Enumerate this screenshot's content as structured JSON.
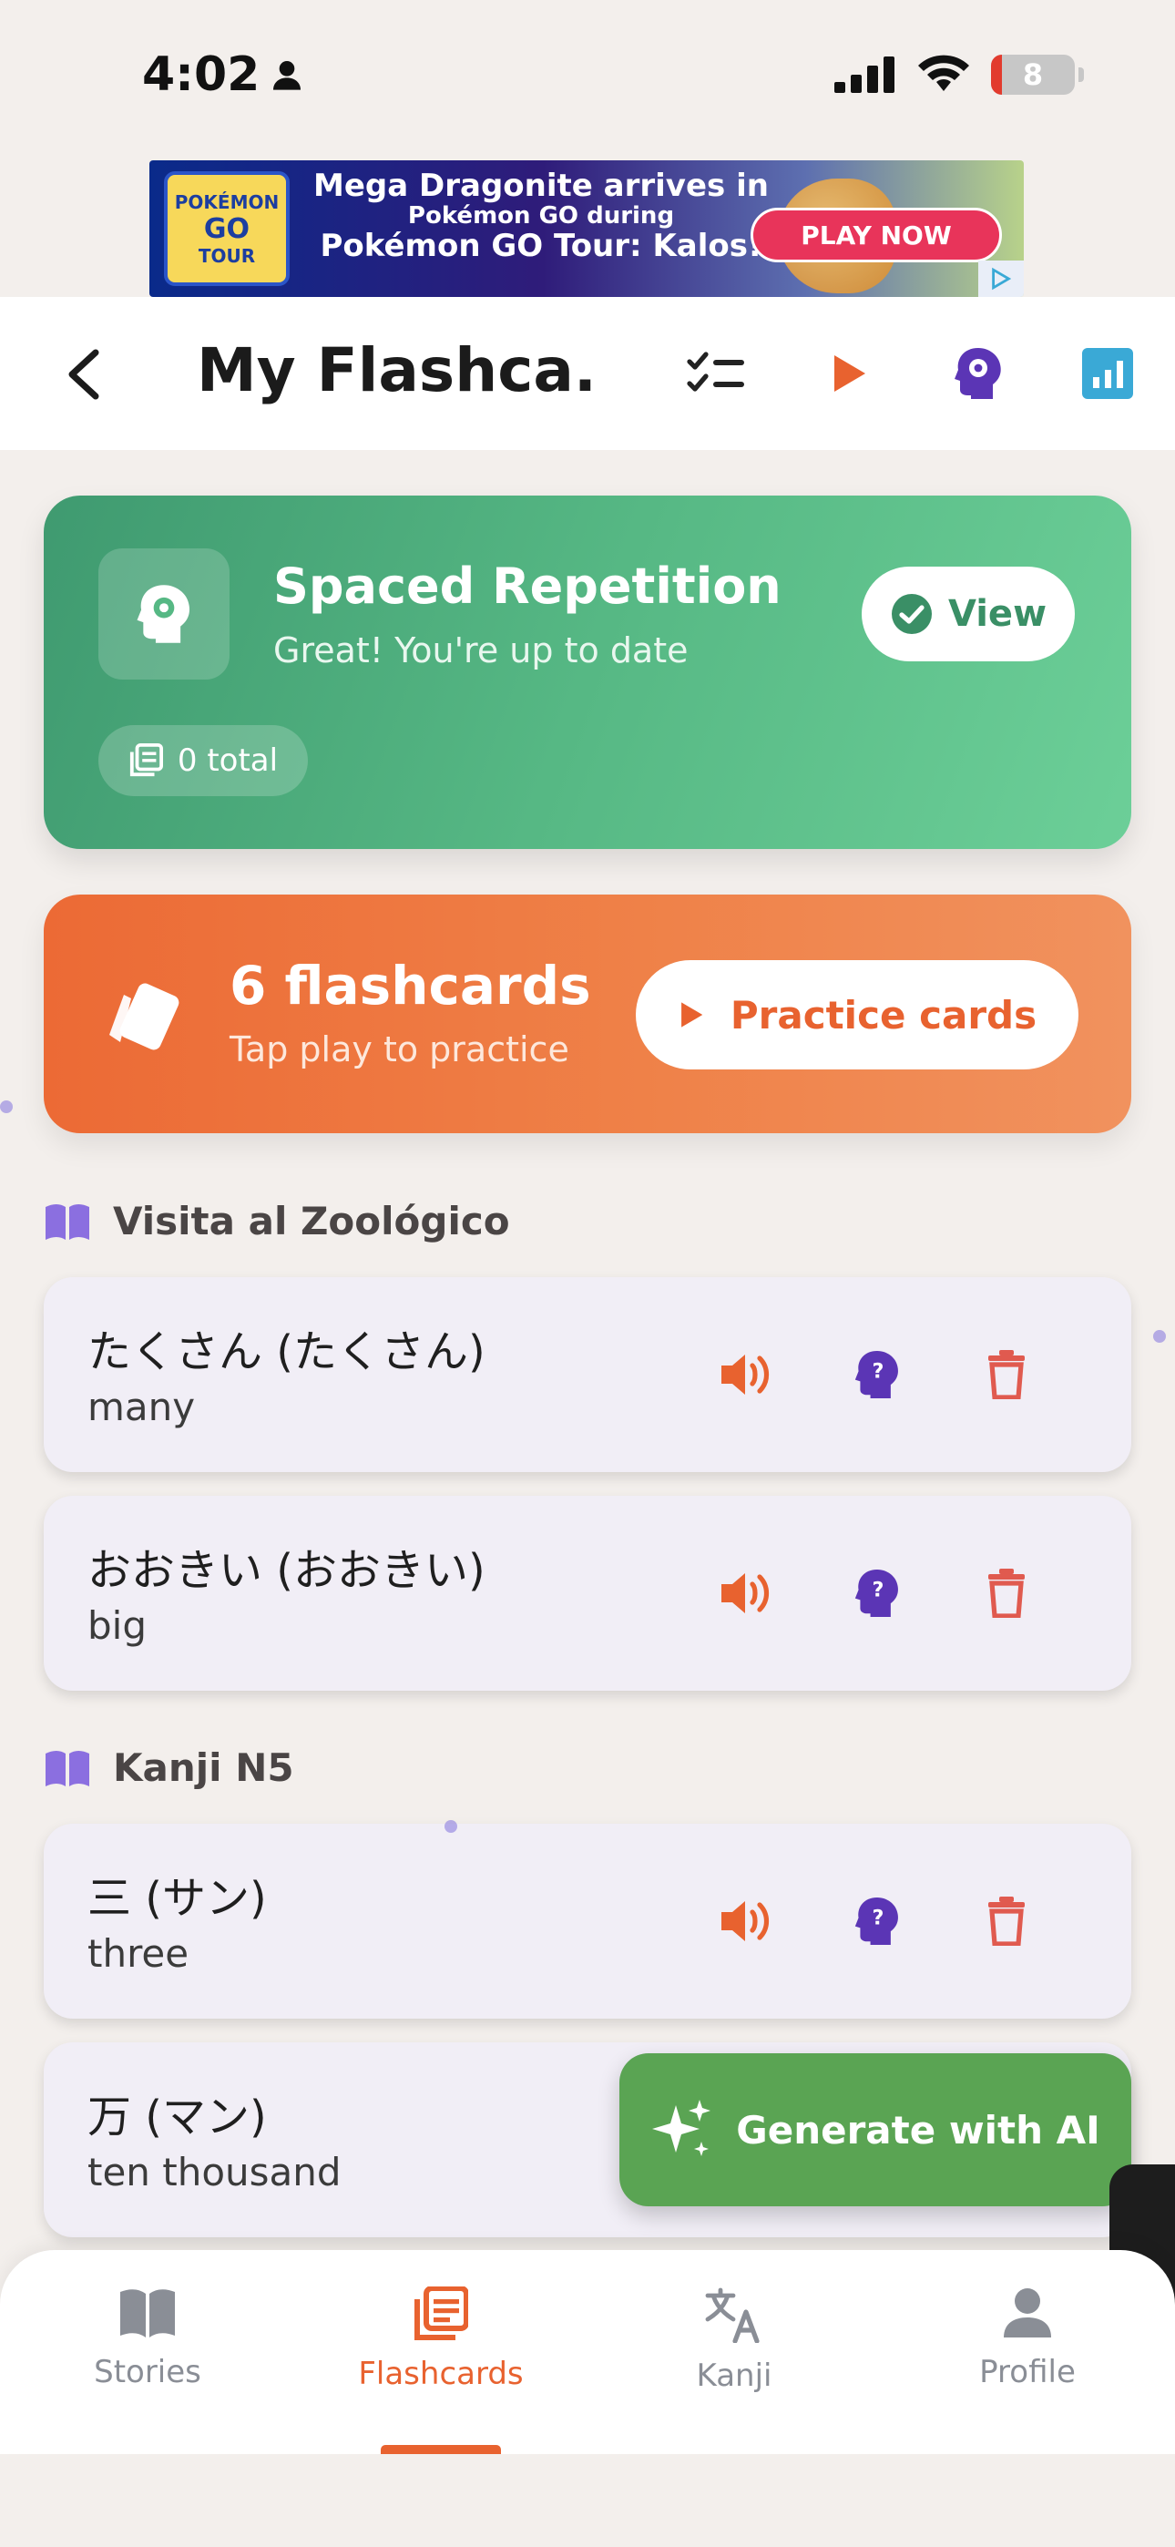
{
  "status_bar": {
    "time": "4:02",
    "battery": "8"
  },
  "ad": {
    "logo_line1": "POKÉMON",
    "logo_line2": "GO",
    "logo_line3": "TOUR",
    "line1": "Mega Dragonite arrives in",
    "line2": "Pokémon GO during",
    "line3": "Pokémon GO Tour: Kalos!",
    "cta": "PLAY NOW"
  },
  "header": {
    "title": "My Flashca...",
    "icons": [
      "back-icon",
      "checklist-icon",
      "play-icon",
      "brain-gear-icon",
      "stats-icon"
    ]
  },
  "spaced_repetition": {
    "title": "Spaced Repetition",
    "subtitle": "Great! You're up to date",
    "view_label": "View",
    "total_label": "0 total"
  },
  "flashcards_summary": {
    "count_label": "6 flashcards",
    "subtitle": "Tap play to practice",
    "practice_label": "Practice cards"
  },
  "sections": [
    {
      "title": "Visita al Zoológico",
      "cards": [
        {
          "term": "たくさん (たくさん)",
          "meaning": "many"
        },
        {
          "term": "おおきい (おおきい)",
          "meaning": "big"
        }
      ]
    },
    {
      "title": "Kanji N5",
      "cards": [
        {
          "term": "三 (サン)",
          "meaning": "three"
        },
        {
          "term": "万 (マン)",
          "meaning": "ten thousand"
        }
      ]
    }
  ],
  "generate_button": {
    "label": "Generate with AI"
  },
  "tabs": [
    {
      "label": "Stories",
      "icon": "book-icon",
      "active": false
    },
    {
      "label": "Flashcards",
      "icon": "cards-icon",
      "active": true
    },
    {
      "label": "Kanji",
      "icon": "translate-icon",
      "active": false
    },
    {
      "label": "Profile",
      "icon": "person-icon",
      "active": false
    }
  ],
  "colors": {
    "accent_orange": "#e8622f",
    "green": "#56b884",
    "purple": "#5b35b5",
    "red": "#e05a4f",
    "teal": "#3aa9d6"
  }
}
